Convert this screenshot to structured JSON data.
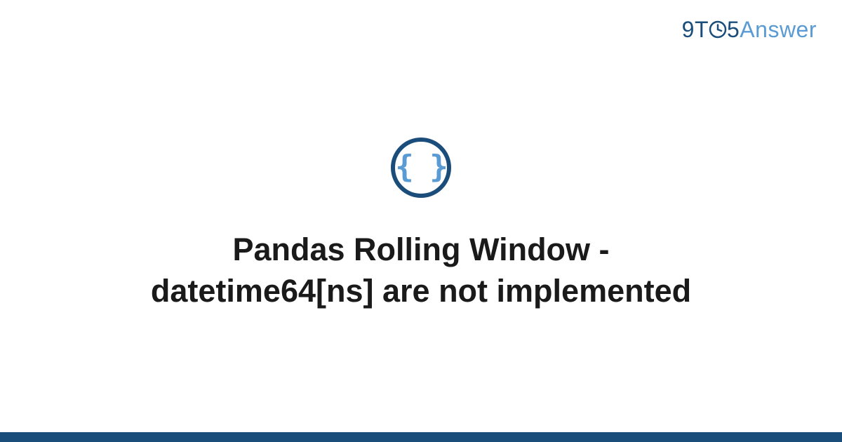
{
  "brand": {
    "part_9": "9",
    "part_T": "T",
    "part_5": "5",
    "part_answer": "Answer"
  },
  "icon": {
    "semantic": "code-braces-icon",
    "glyph": "{ }"
  },
  "title": "Pandas Rolling Window - datetime64[ns] are not implemented",
  "colors": {
    "brand_dark": "#1a4d7a",
    "brand_light": "#5a9bd4",
    "text": "#1a1a1a",
    "background": "#ffffff"
  }
}
